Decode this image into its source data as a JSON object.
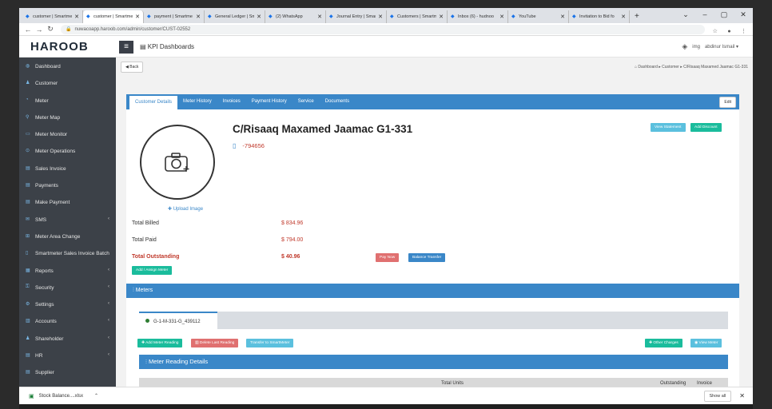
{
  "browser": {
    "tabs": [
      {
        "label": "customer | Smartme",
        "active": false
      },
      {
        "label": "customer | Smartme",
        "active": true
      },
      {
        "label": "payment | Smartme",
        "active": false
      },
      {
        "label": "General Ledger | Sm",
        "active": false
      },
      {
        "label": "(2) WhatsApp",
        "active": false
      },
      {
        "label": "Journal Entry | Smar",
        "active": false
      },
      {
        "label": "Customers | Smartm",
        "active": false
      },
      {
        "label": "Inbox (6) - hudnoo",
        "active": false
      },
      {
        "label": "YouTube",
        "active": false
      },
      {
        "label": "Invitation to Bid fo",
        "active": false
      }
    ],
    "new_tab": "+",
    "url": "nuwacoapp.haroob.com/admin/customer/CUST-02552"
  },
  "header": {
    "logo": "HAROOB",
    "menu_icon": "≡",
    "page_label": "KPI Dashboards",
    "user_name": "abdinur Ismail",
    "user_img_alt": "img"
  },
  "sidebar": {
    "items": [
      {
        "label": "Dashboard",
        "has_caret": false
      },
      {
        "label": "Customer",
        "has_caret": false
      },
      {
        "label": "Meter",
        "has_caret": false
      },
      {
        "label": "Meter Map",
        "has_caret": false
      },
      {
        "label": "Meter Monitor",
        "has_caret": false
      },
      {
        "label": "Meter Operations",
        "has_caret": false
      },
      {
        "label": "Sales Invoice",
        "has_caret": false
      },
      {
        "label": "Payments",
        "has_caret": false
      },
      {
        "label": "Make Payment",
        "has_caret": false
      },
      {
        "label": "SMS",
        "has_caret": true
      },
      {
        "label": "Meter Area Change",
        "has_caret": false
      },
      {
        "label": "Smartmeter Sales Invoice Batch",
        "has_caret": false
      },
      {
        "label": "Reports",
        "has_caret": true
      },
      {
        "label": "Security",
        "has_caret": true
      },
      {
        "label": "Settings",
        "has_caret": true
      },
      {
        "label": "Accounts",
        "has_caret": true
      },
      {
        "label": "Shareholder",
        "has_caret": true
      },
      {
        "label": "HR",
        "has_caret": true
      },
      {
        "label": "Supplier",
        "has_caret": false
      }
    ]
  },
  "breadcrumb": {
    "back": "Back",
    "path": "Dashboard  ▸  Customer  ▸  C/Risaaq Maxamed Jaamac G1-331"
  },
  "tabs": [
    "Customer Details",
    "Meter History",
    "Invoices",
    "Payment History",
    "Service",
    "Documents"
  ],
  "edit_label": "Edit",
  "customer": {
    "name": "C/Risaaq Maxamed Jaamac G1-331",
    "phone": "-794656",
    "upload_label": "Upload Image"
  },
  "actions": {
    "view_statement": "View Statement",
    "add_discount": "Add Discount",
    "pay_now": "Pay Now",
    "balance_transfer": "Balance Transfer",
    "add_assign_meter": "Add / Assign Meter"
  },
  "summary": {
    "total_billed_label": "Total Billed",
    "total_billed": "$ 834.96",
    "total_paid_label": "Total Paid",
    "total_paid": "$ 794.00",
    "total_outstanding_label": "Total Outstanding",
    "total_outstanding": "$ 40.96"
  },
  "meters": {
    "title": "Meters",
    "meter_tab": "G-1-M-331-G_439112",
    "add_reading": "Add Meter Reading",
    "delete_reading": "Delete Last Reading",
    "transfer": "Transfer to SmartMeter",
    "other_charges": "Other Charges",
    "view_meter": "View Meter",
    "reading_title": "Meter Reading Details",
    "columns": {
      "total_units": "Total Units",
      "outstanding": "Outstanding",
      "invoice": "Invoice"
    }
  },
  "downloads": {
    "file": "Stock Balance....xlsx",
    "show_all": "Show all"
  },
  "colors": {
    "primary": "#3a87c8",
    "success": "#1abc9c",
    "danger": "#e07070",
    "info": "#5bc0de",
    "sidebar": "#3c4148"
  }
}
